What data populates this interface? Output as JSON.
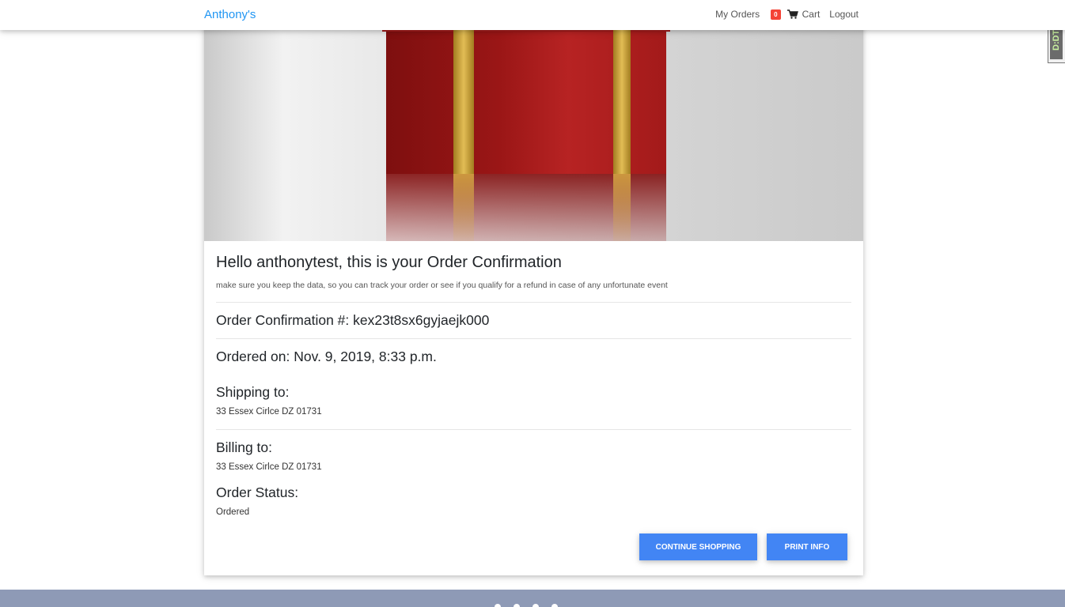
{
  "navbar": {
    "brand": "Anthony's",
    "my_orders": "My Orders",
    "cart_count": "0",
    "cart": "Cart",
    "logout": "Logout"
  },
  "extension": {
    "label": "D:DT"
  },
  "order": {
    "greeting": "Hello anthonytest, this is your Order Confirmation",
    "note": "make sure you keep the data, so you can track your order or see if you qualify for a refund in case of any unfortunate event",
    "confirmation": "Order Confirmation #: kex23t8sx6gyjaejk000",
    "ordered_on": "Ordered on: Nov. 9, 2019, 8:33 p.m.",
    "shipping_heading": "Shipping to:",
    "shipping_address": "33 Essex Cirlce DZ 01731",
    "billing_heading": "Billing to:",
    "billing_address": "33 Essex Cirlce DZ 01731",
    "status_heading": "Order Status:",
    "status_value": "Ordered"
  },
  "buttons": {
    "continue": "Continue Shopping",
    "print": "Print Info"
  },
  "colors": {
    "brand": "#2196f3",
    "primary_button": "#4285f4",
    "badge": "#f44336",
    "footer": "#8e9ab6"
  }
}
